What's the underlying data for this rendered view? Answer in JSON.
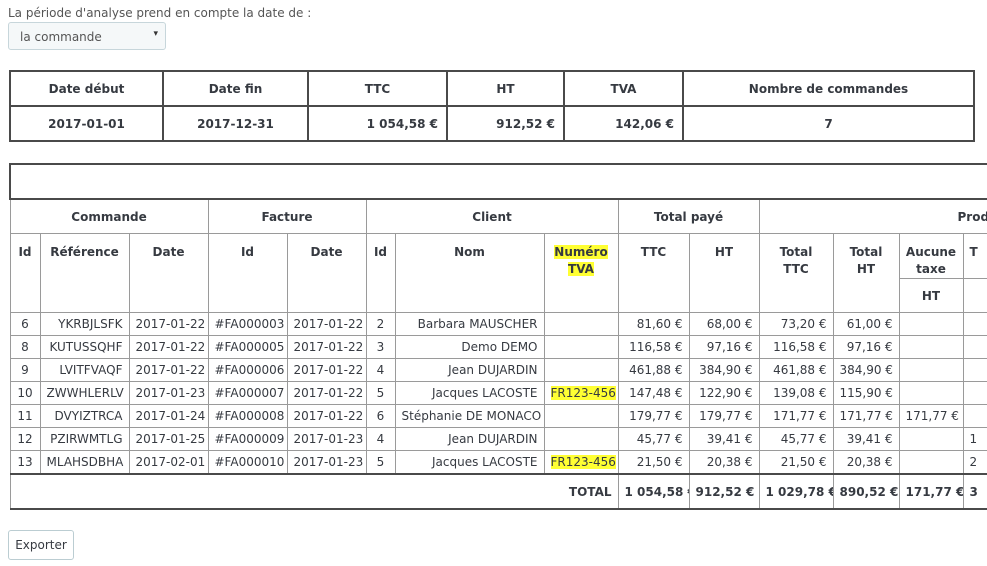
{
  "intro_text": "La période d'analyse prend en compte la date de :",
  "select": {
    "value": "la commande",
    "caret": "▾"
  },
  "summary": {
    "headers": [
      "Date début",
      "Date fin",
      "TTC",
      "HT",
      "TVA",
      "Nombre de commandes"
    ],
    "values": [
      "2017-01-01",
      "2017-12-31",
      "1 054,58 €",
      "912,52 €",
      "142,06 €",
      "7"
    ]
  },
  "detail": {
    "groups": [
      "Commande",
      "Facture",
      "Client",
      "Total payé",
      "Produits"
    ],
    "columns": {
      "cmd_id": "Id",
      "cmd_ref": "Référence",
      "cmd_date": "Date",
      "fac_id": "Id",
      "fac_date": "Date",
      "cli_id": "Id",
      "cli_nom": "Nom",
      "cli_tva_line1": "Numéro",
      "cli_tva_line2": "TVA",
      "paid_ttc": "TTC",
      "paid_ht": "HT",
      "prod_total_ttc": "Total TTC",
      "prod_total_ht_line1": "Total",
      "prod_total_ht_line2": "HT",
      "prod_aucune_line1": "Aucune",
      "prod_aucune_line2": "taxe",
      "prod_next": "T",
      "prod_aucune_sub": "HT"
    },
    "rows": [
      {
        "id": "6",
        "ref": "YKRBJLSFK",
        "date": "2017-01-22",
        "fid": "#FA000003",
        "fdate": "2017-01-22",
        "cid": "2",
        "nom": "Barbara MAUSCHER",
        "tva": "",
        "ttc": "81,60 €",
        "ht": "68,00 €",
        "pttc": "73,20 €",
        "pht": "61,00 €",
        "aucune": "",
        "next": ""
      },
      {
        "id": "8",
        "ref": "KUTUSSQHF",
        "date": "2017-01-22",
        "fid": "#FA000005",
        "fdate": "2017-01-22",
        "cid": "3",
        "nom": "Demo DEMO",
        "tva": "",
        "ttc": "116,58 €",
        "ht": "97,16 €",
        "pttc": "116,58 €",
        "pht": "97,16 €",
        "aucune": "",
        "next": ""
      },
      {
        "id": "9",
        "ref": "LVITFVAQF",
        "date": "2017-01-22",
        "fid": "#FA000006",
        "fdate": "2017-01-22",
        "cid": "4",
        "nom": "Jean DUJARDIN",
        "tva": "",
        "ttc": "461,88 €",
        "ht": "384,90 €",
        "pttc": "461,88 €",
        "pht": "384,90 €",
        "aucune": "",
        "next": ""
      },
      {
        "id": "10",
        "ref": "ZWWHLERLV",
        "date": "2017-01-23",
        "fid": "#FA000007",
        "fdate": "2017-01-22",
        "cid": "5",
        "nom": "Jacques LACOSTE",
        "tva": "FR123-456",
        "ttc": "147,48 €",
        "ht": "122,90 €",
        "pttc": "139,08 €",
        "pht": "115,90 €",
        "aucune": "",
        "next": ""
      },
      {
        "id": "11",
        "ref": "DVYIZTRCA",
        "date": "2017-01-24",
        "fid": "#FA000008",
        "fdate": "2017-01-22",
        "cid": "6",
        "nom": "Stéphanie DE MONACO",
        "tva": "",
        "ttc": "179,77 €",
        "ht": "179,77 €",
        "pttc": "171,77 €",
        "pht": "171,77 €",
        "aucune": "171,77 €",
        "next": ""
      },
      {
        "id": "12",
        "ref": "PZIRWMTLG",
        "date": "2017-01-25",
        "fid": "#FA000009",
        "fdate": "2017-01-23",
        "cid": "4",
        "nom": "Jean DUJARDIN",
        "tva": "",
        "ttc": "45,77 €",
        "ht": "39,41 €",
        "pttc": "45,77 €",
        "pht": "39,41 €",
        "aucune": "",
        "next": "1"
      },
      {
        "id": "13",
        "ref": "MLAHSDBHA",
        "date": "2017-02-01",
        "fid": "#FA000010",
        "fdate": "2017-01-23",
        "cid": "5",
        "nom": "Jacques LACOSTE",
        "tva": "FR123-456",
        "ttc": "21,50 €",
        "ht": "20,38 €",
        "pttc": "21,50 €",
        "pht": "20,38 €",
        "aucune": "",
        "next": "2"
      }
    ],
    "total": {
      "label": "TOTAL",
      "ttc": "1 054,58 €",
      "ht": "912,52 €",
      "pttc": "1 029,78 €",
      "pht": "890,52 €",
      "aucune": "171,77 €",
      "next": "3"
    }
  },
  "export_label": "Exporter",
  "colors": {
    "highlight": "#ffff33",
    "border": "#4a4a4a"
  }
}
